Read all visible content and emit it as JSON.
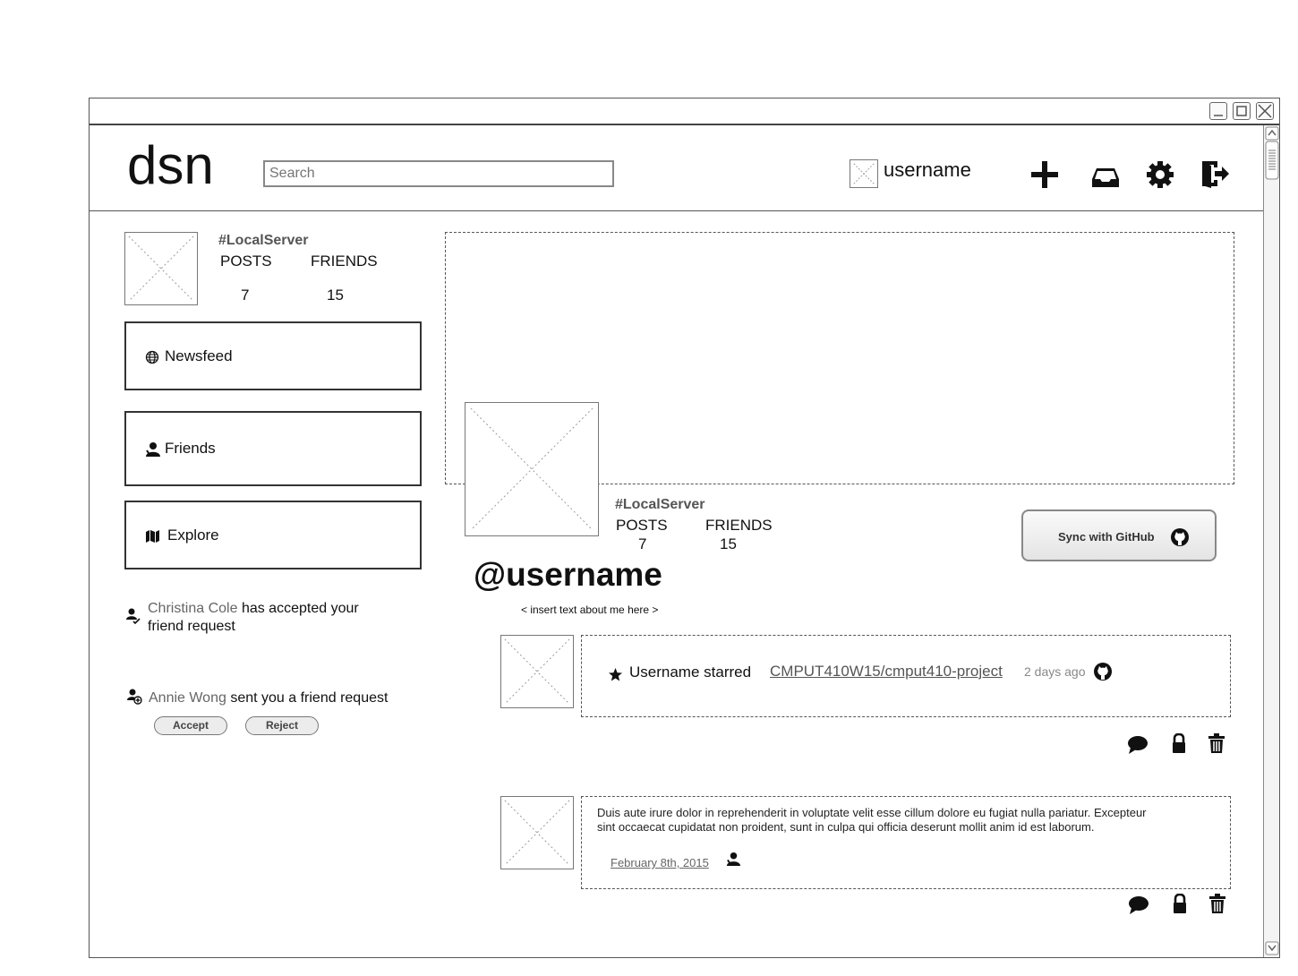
{
  "header": {
    "logo": "dsn",
    "search_placeholder": "Search",
    "username": "username"
  },
  "icons": {
    "add": "plus-icon",
    "inbox": "inbox-icon",
    "settings": "gear-icon",
    "logout": "logout-icon"
  },
  "sidebar": {
    "server_tag": "#LocalServer",
    "posts_label": "POSTS",
    "friends_label": "FRIENDS",
    "posts_count": "7",
    "friends_count": "15",
    "nav": [
      {
        "label": "Newsfeed",
        "icon": "globe-icon"
      },
      {
        "label": "Friends",
        "icon": "user-icon"
      },
      {
        "label": "Explore",
        "icon": "map-icon"
      }
    ],
    "notifications": [
      {
        "name": "Christina Cole",
        "text_line1": "has accepted your",
        "text_line2": "friend request"
      },
      {
        "name": "Annie Wong",
        "text": "sent you a friend request",
        "accept": "Accept",
        "reject": "Reject"
      }
    ]
  },
  "profile": {
    "server_tag": "#LocalServer",
    "posts_label": "POSTS",
    "friends_label": "FRIENDS",
    "posts_count": "7",
    "friends_count": "15",
    "handle": "@username",
    "about": "< insert text about me here >",
    "sync_button": "Sync with GitHub"
  },
  "feed": [
    {
      "actor": "Username starred",
      "link": "CMPUT410W15/cmput410-project",
      "time": "2 days ago"
    },
    {
      "body_line1": "Duis aute irure dolor in reprehenderit in voluptate velit esse cillum dolore eu fugiat nulla pariatur. Excepteur",
      "body_line2": "sint occaecat cupidatat non proident, sunt in culpa qui officia deserunt mollit anim id est laborum.",
      "date": "February 8th, 2015"
    }
  ]
}
